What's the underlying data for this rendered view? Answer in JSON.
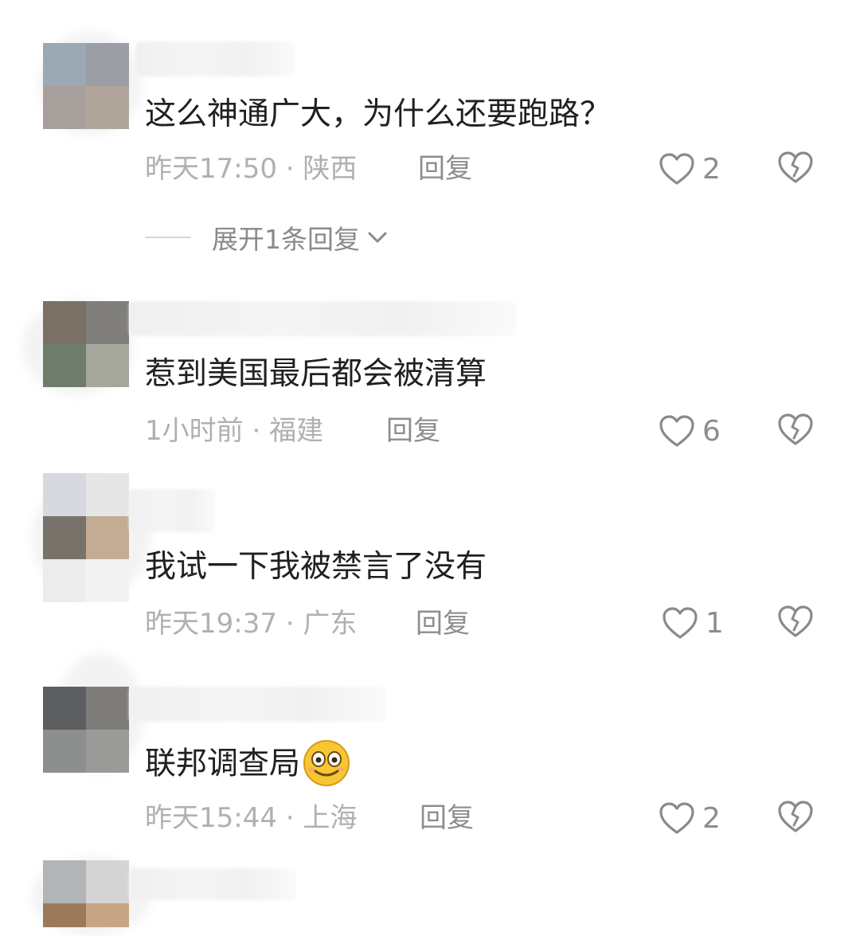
{
  "comments": [
    {
      "text": "这么神通广大，为什么还要跑路？",
      "time": "昨天17:50",
      "location": "陕西",
      "reply_label": "回复",
      "likes": "2",
      "avatar_colors": [
        "#9aa9b4",
        "#9b9ea5",
        "#a79f9c",
        "#b1a69b"
      ]
    },
    {
      "text": "惹到美国最后都会被清算",
      "time": "1小时前",
      "location": "福建",
      "reply_label": "回复",
      "likes": "6",
      "avatar_colors": [
        "#7b7066",
        "#807f7b",
        "#6e7d6b",
        "#a6a79c"
      ]
    },
    {
      "text": "我试一下我被禁言了没有",
      "time": "昨天19:37",
      "location": "广东",
      "reply_label": "回复",
      "likes": "1",
      "avatar_colors": [
        "#d8d9de",
        "#e6e6e6",
        "#77726a",
        "#c2ad94"
      ]
    },
    {
      "text": "联邦调查局",
      "time": "昨天15:44",
      "location": "上海",
      "reply_label": "回复",
      "likes": "2",
      "avatar_colors": [
        "#5d5e60",
        "#7d7c79",
        "#8d8e8e",
        "#9a9a99"
      ]
    },
    {
      "avatar_colors": [
        "#b2b5b6",
        "#d4d4d4",
        "#9a7a5a",
        "#c6a684"
      ]
    }
  ],
  "separator": " · ",
  "expand_label": "展开1条回复",
  "icons": {
    "like": "heart-outline-icon",
    "dislike": "broken-heart-icon",
    "expand": "chevron-down-icon",
    "emoji": "smiling-face-emoji"
  },
  "colors": {
    "meta_text": "#b0b0b0",
    "action_text": "#8d8d8d",
    "comment_text": "#202020"
  }
}
